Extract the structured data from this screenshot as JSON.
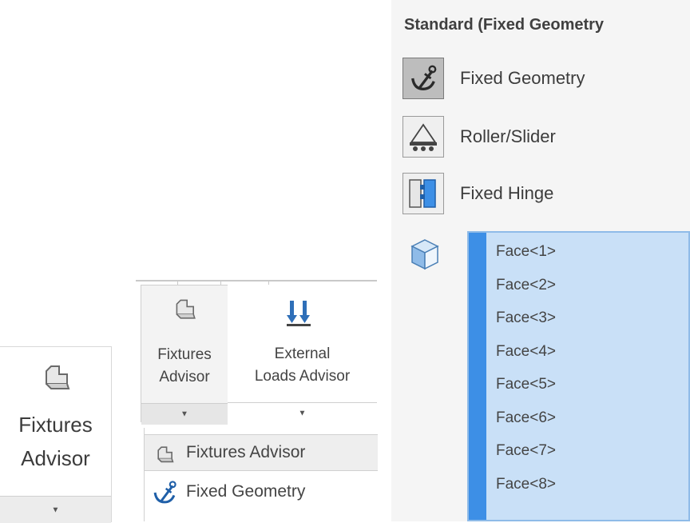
{
  "small_button": {
    "label_line1": "Fixtures",
    "label_line2": "Advisor",
    "icon": "fixtures-advisor-icon"
  },
  "ribbon": {
    "fixtures_advisor": {
      "line1": "Fixtures",
      "line2": "Advisor",
      "icon": "fixtures-advisor-icon"
    },
    "external_loads_advisor": {
      "line1": "External",
      "line2": "Loads Advisor",
      "icon": "external-loads-icon"
    },
    "menu_items": [
      {
        "label": "Fixtures Advisor",
        "icon": "fixtures-advisor-icon"
      },
      {
        "label": "Fixed Geometry",
        "icon": "anchor-icon"
      }
    ]
  },
  "panel": {
    "title": "Standard (Fixed Geometry",
    "options": [
      {
        "label": "Fixed Geometry",
        "icon": "anchor-icon",
        "active": true
      },
      {
        "label": "Roller/Slider",
        "icon": "roller-slider-icon",
        "active": false
      },
      {
        "label": "Fixed Hinge",
        "icon": "hinge-icon",
        "active": false
      }
    ],
    "faces": [
      "Face<1>",
      "Face<2>",
      "Face<3>",
      "Face<4>",
      "Face<5>",
      "Face<6>",
      "Face<7>",
      "Face<8>"
    ]
  },
  "colors": {
    "selection_bg": "#c9e0f7",
    "selection_bar": "#3d8fe6",
    "anchor_blue": "#1f5fa8"
  }
}
